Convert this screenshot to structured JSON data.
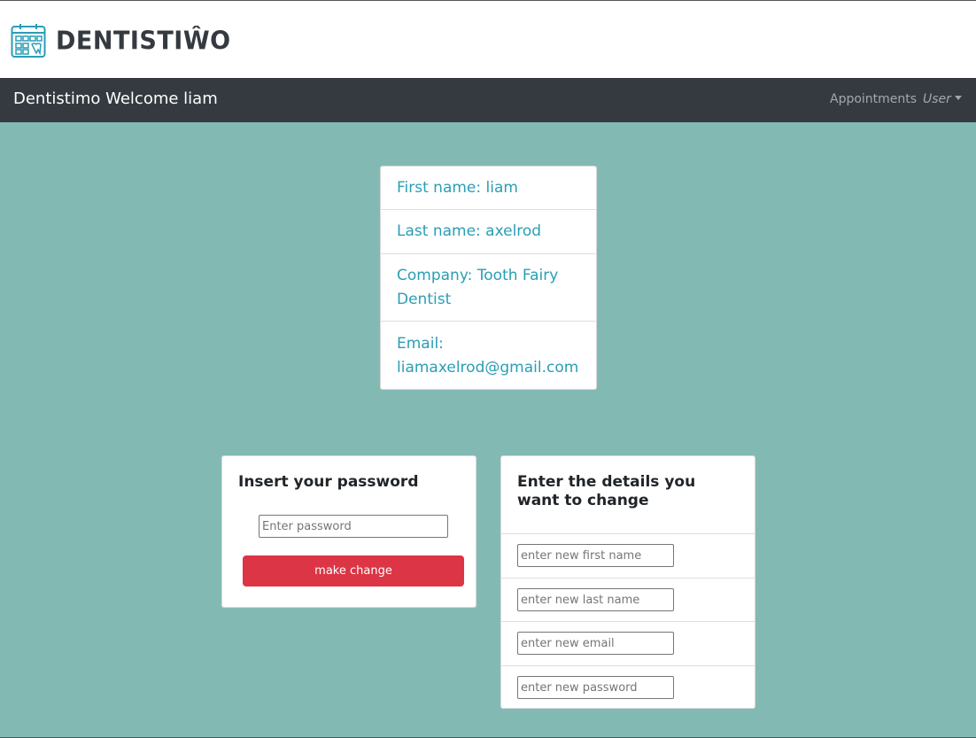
{
  "header": {
    "logo_text": "DENTISTIŴO",
    "logo_icon": "calendar-tooth-icon"
  },
  "navbar": {
    "brand": "Dentistimo Welcome liam",
    "appointments": "Appointments",
    "user": "User"
  },
  "profile": {
    "first_name": "First name: liam",
    "last_name": "Last name: axelrod",
    "company": "Company: Tooth Fairy Dentist",
    "email": "Email: liamaxelrod@gmail.com"
  },
  "password_card": {
    "title": "Insert your password",
    "placeholder": "Enter password",
    "button_label": "make change"
  },
  "details_card": {
    "title": "Enter the details you want to change",
    "first_name_placeholder": "enter new first name",
    "last_name_placeholder": "enter new last name",
    "email_placeholder": "enter new email",
    "password_placeholder": "enter new password"
  },
  "colors": {
    "background": "#82bab3",
    "navbar": "#343a40",
    "accent_text": "#2a9eb5",
    "danger": "#dc3545"
  }
}
